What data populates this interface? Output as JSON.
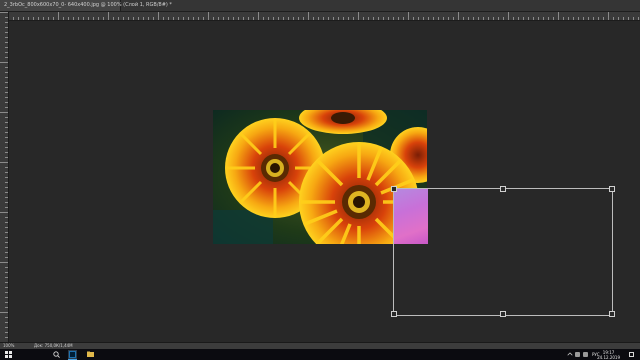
{
  "document_tab": {
    "label": "2_3rbOc_800x600x70_0- 640x400.jpg @ 100% (Слой 1, RGB/8#) *"
  },
  "status_bar": {
    "zoom": "100%",
    "doc_size": "Док: 750,0К/1,44М"
  },
  "taskbar": {
    "language": "РУС",
    "time": "19:17",
    "date": "24.12.2019"
  },
  "colors": {
    "workspace": "#282828",
    "ruler": "#3a3a3a",
    "taskbar": "#0b0b10",
    "photoshop_blue": "#31a8ff"
  },
  "icons": [
    "windows-start-icon",
    "search-icon",
    "photoshop-icon",
    "file-explorer-icon",
    "tray-chevron-icon",
    "network-icon",
    "volume-icon",
    "notifications-icon"
  ]
}
